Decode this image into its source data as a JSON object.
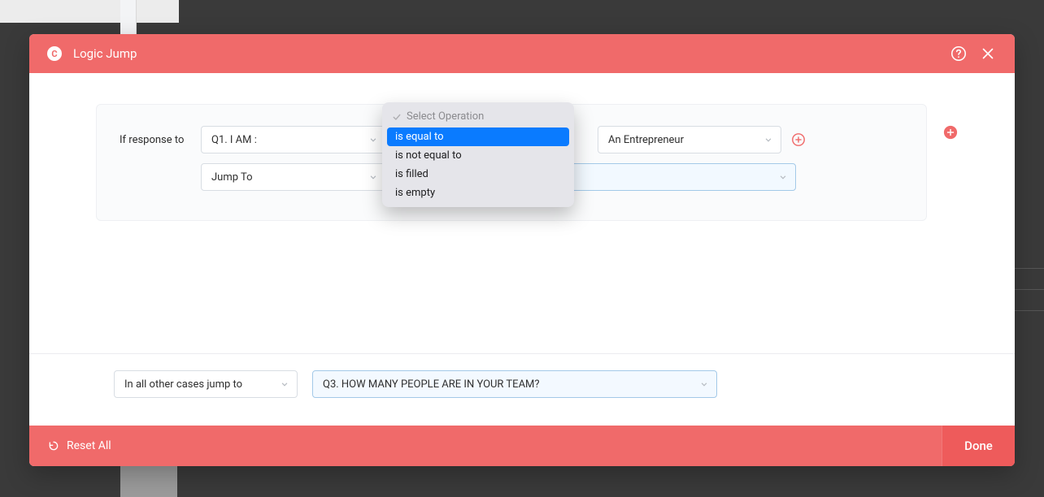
{
  "header": {
    "title": "Logic Jump",
    "brand_glyph": "C"
  },
  "rule": {
    "prompt_label": "If response to",
    "question": "Q1. I AM :",
    "operation_placeholder": "Select Operation",
    "operation_options": {
      "o0": "is equal to",
      "o1": "is not equal to",
      "o2": "is filled",
      "o3": "is empty"
    },
    "value": "An Entrepreneur",
    "action": "Jump To",
    "target": ""
  },
  "fallback": {
    "label": "In all other cases jump to",
    "target": "Q3. HOW MANY PEOPLE ARE IN YOUR TEAM?"
  },
  "footer": {
    "reset_label": "Reset All",
    "done_label": "Done"
  }
}
